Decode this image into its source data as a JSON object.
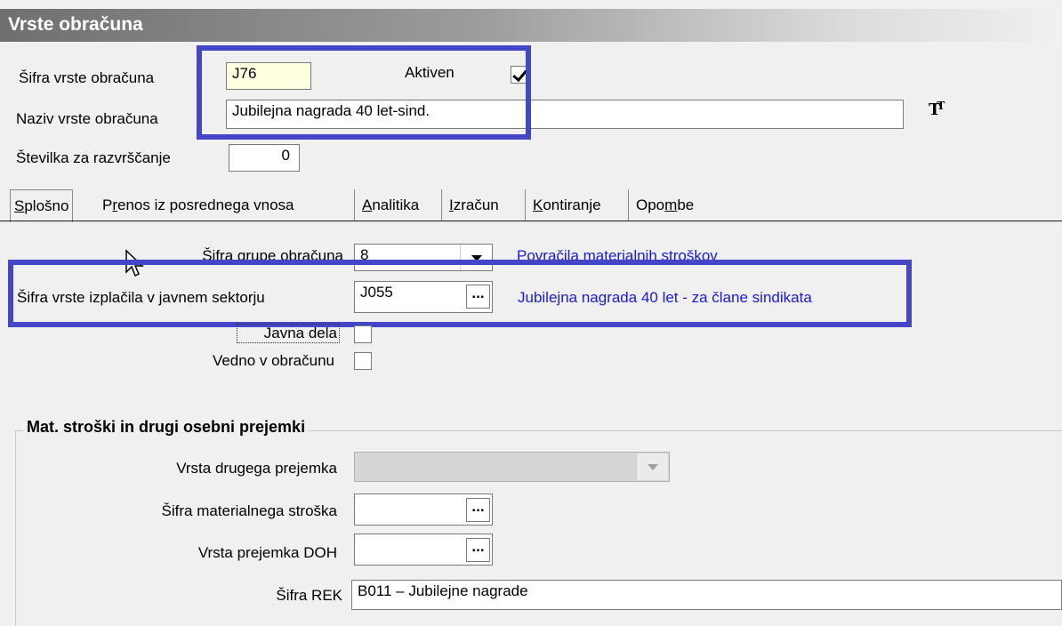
{
  "window": {
    "title": "Vrste obračuna"
  },
  "header": {
    "code_label": "Šifra vrste obračuna",
    "code_value": "J76",
    "active_label": "Aktiven",
    "active_checked": true,
    "name_label": "Naziv vrste obračuna",
    "name_value": "Jubilejna nagrada 40 let-sind.",
    "sort_label": "Številka  za razvrščanje",
    "sort_value": "0",
    "font_icon": "text-format-icon"
  },
  "tabs": [
    {
      "label": "Splošno",
      "active": true
    },
    {
      "label": "Prenos iz posrednega vnosa",
      "active": false
    },
    {
      "label": "Analitika",
      "active": false
    },
    {
      "label": "Izračun",
      "active": false
    },
    {
      "label": "Kontiranje",
      "active": false
    },
    {
      "label": "Opombe",
      "active": false
    }
  ],
  "general": {
    "group_label": "Šifra grupe obračuna",
    "group_value": "8",
    "group_desc": "Povračila materialnih stroškov",
    "public_sector_label": "Šifra vrste izplačila v javnem sektorju",
    "public_sector_value": "J055",
    "public_sector_desc": "Jubilejna nagrada 40 let - za člane sindikata",
    "public_works_label": "Javna dela",
    "always_label": "Vedno v obračunu"
  },
  "mat_costs": {
    "title": "Mat. stroški in drugi osebni prejemki",
    "other_income_label": "Vrsta drugega prejemka",
    "other_income_value": "",
    "material_cost_label": "Šifra materialnega stroška",
    "material_cost_value": "",
    "doh_label": "Vrsta prejemka DOH",
    "doh_value": "",
    "rek_label": "Šifra REK",
    "rek_value": "B011 – Jubilejne nagrade"
  },
  "colors": {
    "highlight": "#4545c8",
    "link": "#1a1ad8"
  }
}
